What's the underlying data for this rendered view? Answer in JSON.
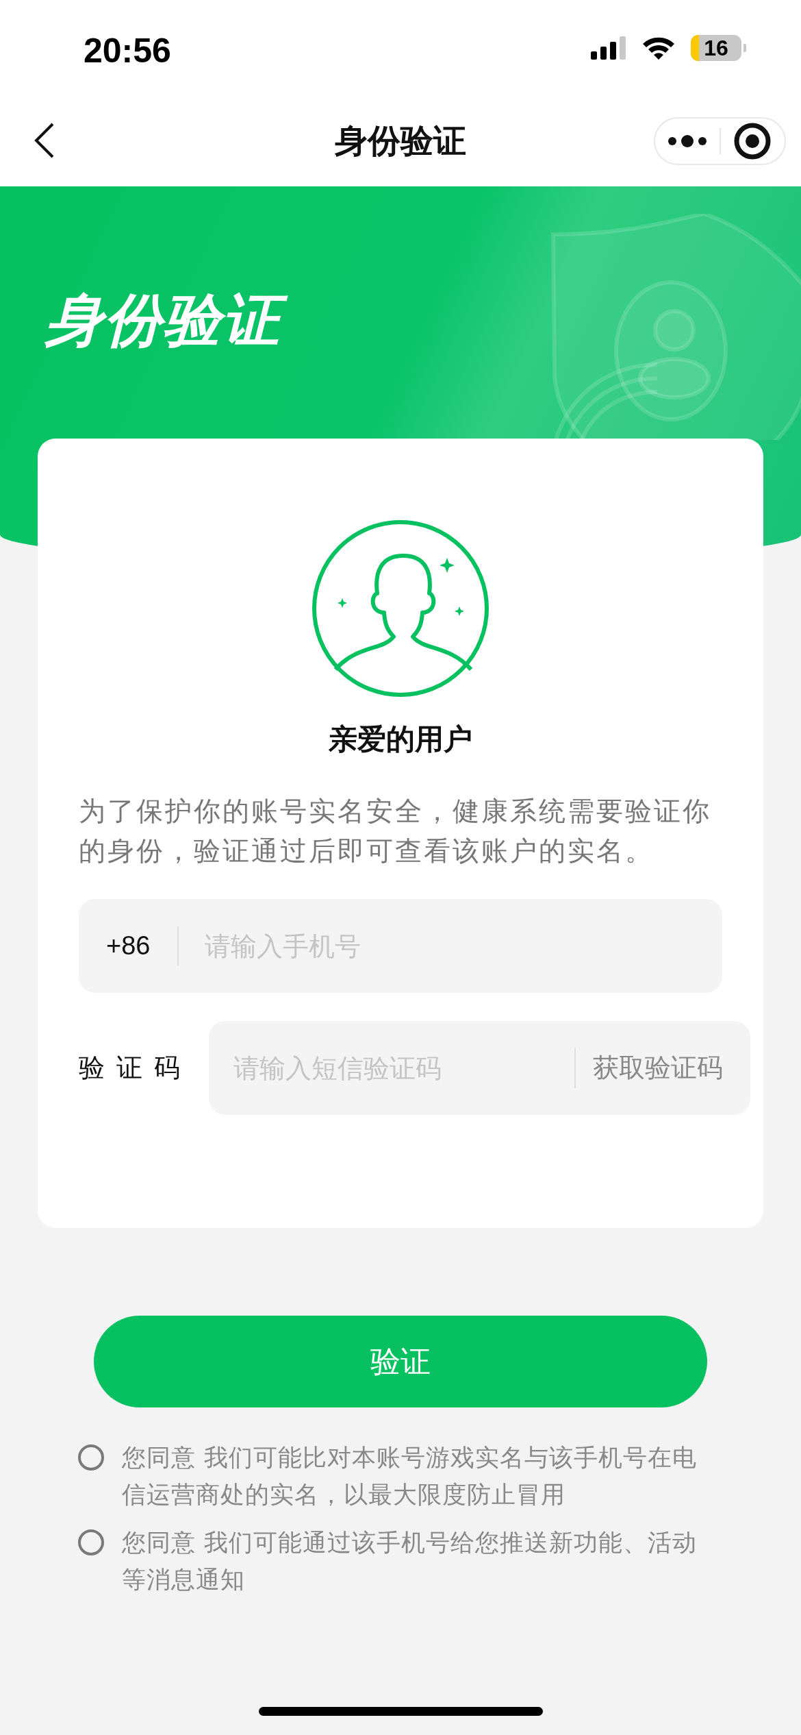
{
  "status_bar": {
    "time": "20:56",
    "battery": "16"
  },
  "nav_bar": {
    "title": "身份验证"
  },
  "hero": {
    "title": "身份验证"
  },
  "card": {
    "greeting": "亲爱的用户",
    "description": "为了保护你的账号实名安全，健康系统需要验证你的身份，验证通过后即可查看该账户的实名。",
    "phone": {
      "prefix": "+86",
      "placeholder": "请输入手机号"
    },
    "code": {
      "label": "验证码",
      "placeholder": "请输入短信验证码",
      "action": "获取验证码"
    }
  },
  "verify_button": "验证",
  "consents": [
    {
      "text": "您同意 我们可能比对本账号游戏实名与该手机号在电信运营商处的实名，以最大限度防止冒用",
      "checked": false
    },
    {
      "text": "您同意 我们可能通过该手机号给您推送新功能、活动等消息通知",
      "checked": false
    }
  ]
}
